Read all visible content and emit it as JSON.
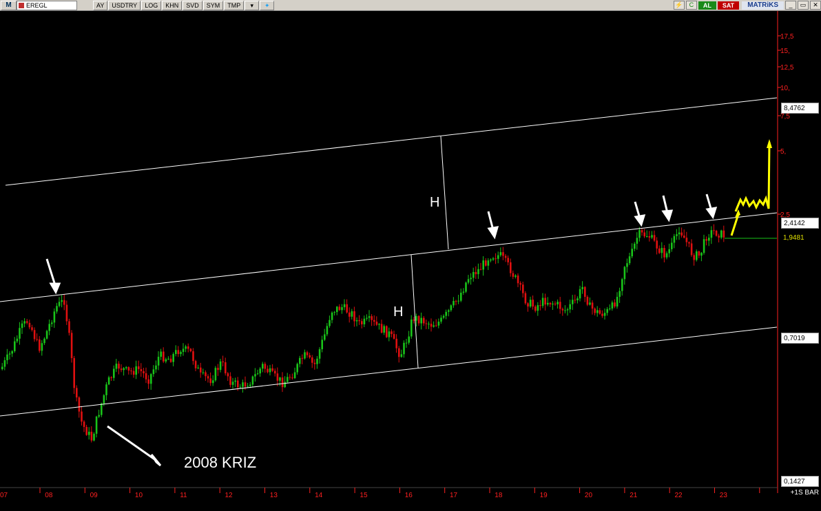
{
  "toolbar": {
    "logo": "M",
    "symbol": "EREGL",
    "buttons": [
      "AY",
      "USDTRY",
      "LOG",
      "KHN",
      "SVD",
      "SYM",
      "TMP"
    ],
    "buy_label": "AL",
    "sell_label": "SAT",
    "brand": "MATRiKS"
  },
  "colors": {
    "up_candle": "#19c419",
    "down_candle": "#e01010",
    "background": "#000000",
    "axis": "#ff2020",
    "channel": "#ffffff",
    "projection": "#ffff00"
  },
  "y_axis_ticks": [
    "17,5",
    "15,",
    "12,5",
    "10,",
    "7,5",
    "5,",
    "2,5"
  ],
  "x_axis_ticks": [
    "07",
    "08",
    "09",
    "10",
    "11",
    "12",
    "13",
    "14",
    "15",
    "16",
    "17",
    "18",
    "19",
    "20",
    "21",
    "22",
    "23"
  ],
  "price_tags": {
    "upper": "8,4762",
    "middle": "2,4142",
    "last": "1,9481",
    "lower": "0,7019",
    "min": "0,1427"
  },
  "annotations": {
    "h1": "H",
    "h2": "H",
    "crisis": "2008 KRIZ",
    "corner": "+1S BAR"
  },
  "chart_data": {
    "type": "candlestick",
    "symbol": "EREGL",
    "scale": "log",
    "y_ticks": [
      2.5,
      5,
      7.5,
      10,
      12.5,
      15,
      17.5
    ],
    "x_ticks": [
      "07",
      "08",
      "09",
      "10",
      "11",
      "12",
      "13",
      "14",
      "15",
      "16",
      "17",
      "18",
      "19",
      "20",
      "21",
      "22",
      "23"
    ],
    "levels": {
      "upper_channel": 8.4762,
      "middle_channel": 2.4142,
      "last_price": 1.9481,
      "lower_channel": 0.7019,
      "min": 0.1427
    }
  }
}
